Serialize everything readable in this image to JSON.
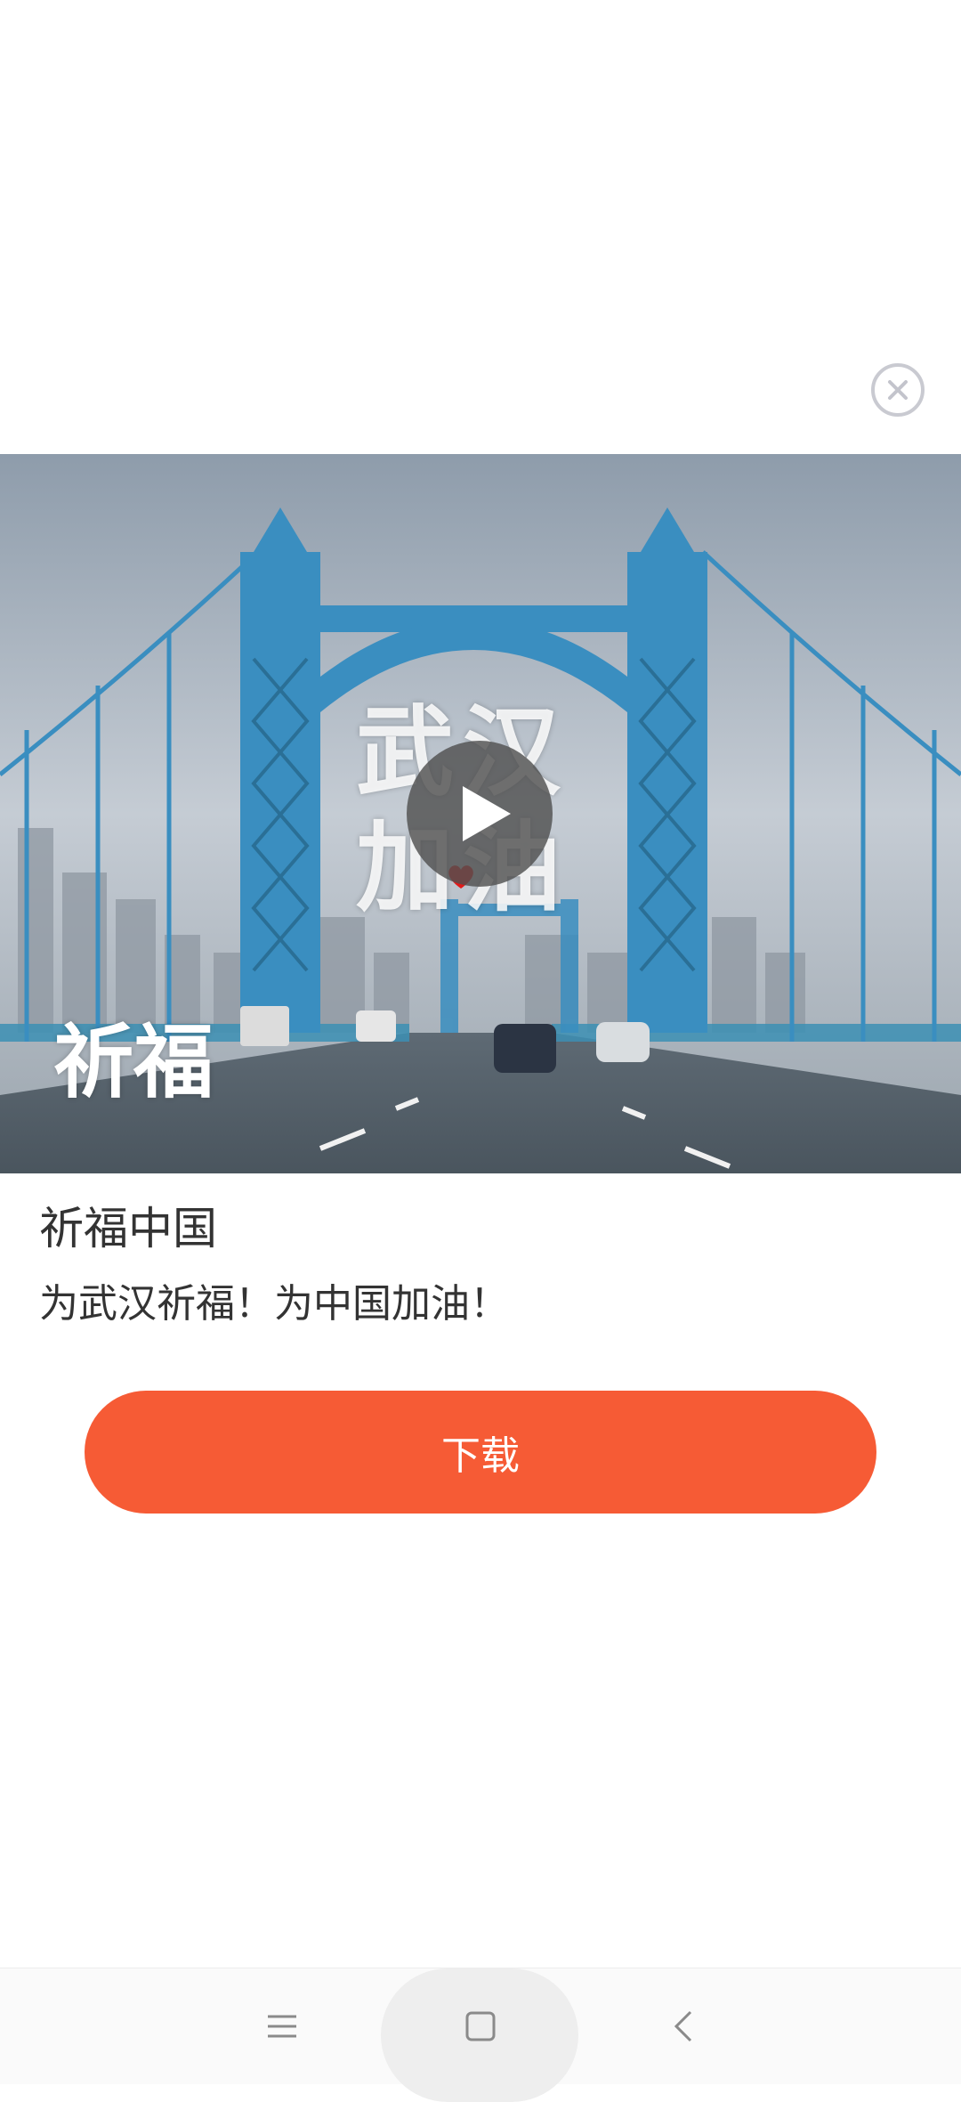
{
  "ad": {
    "title": "祈福中国",
    "description": "为武汉祈福！为中国加油！",
    "download_label": "下载",
    "accent_color": "#f65b35"
  },
  "video": {
    "overlay_line1": "武汉",
    "overlay_line2": "加油",
    "calligraphy": "祈福",
    "play_icon": "play-icon"
  },
  "controls": {
    "close_icon": "close-icon"
  },
  "navbar": {
    "menu_icon": "menu-icon",
    "home_icon": "home-icon",
    "back_icon": "back-icon"
  }
}
